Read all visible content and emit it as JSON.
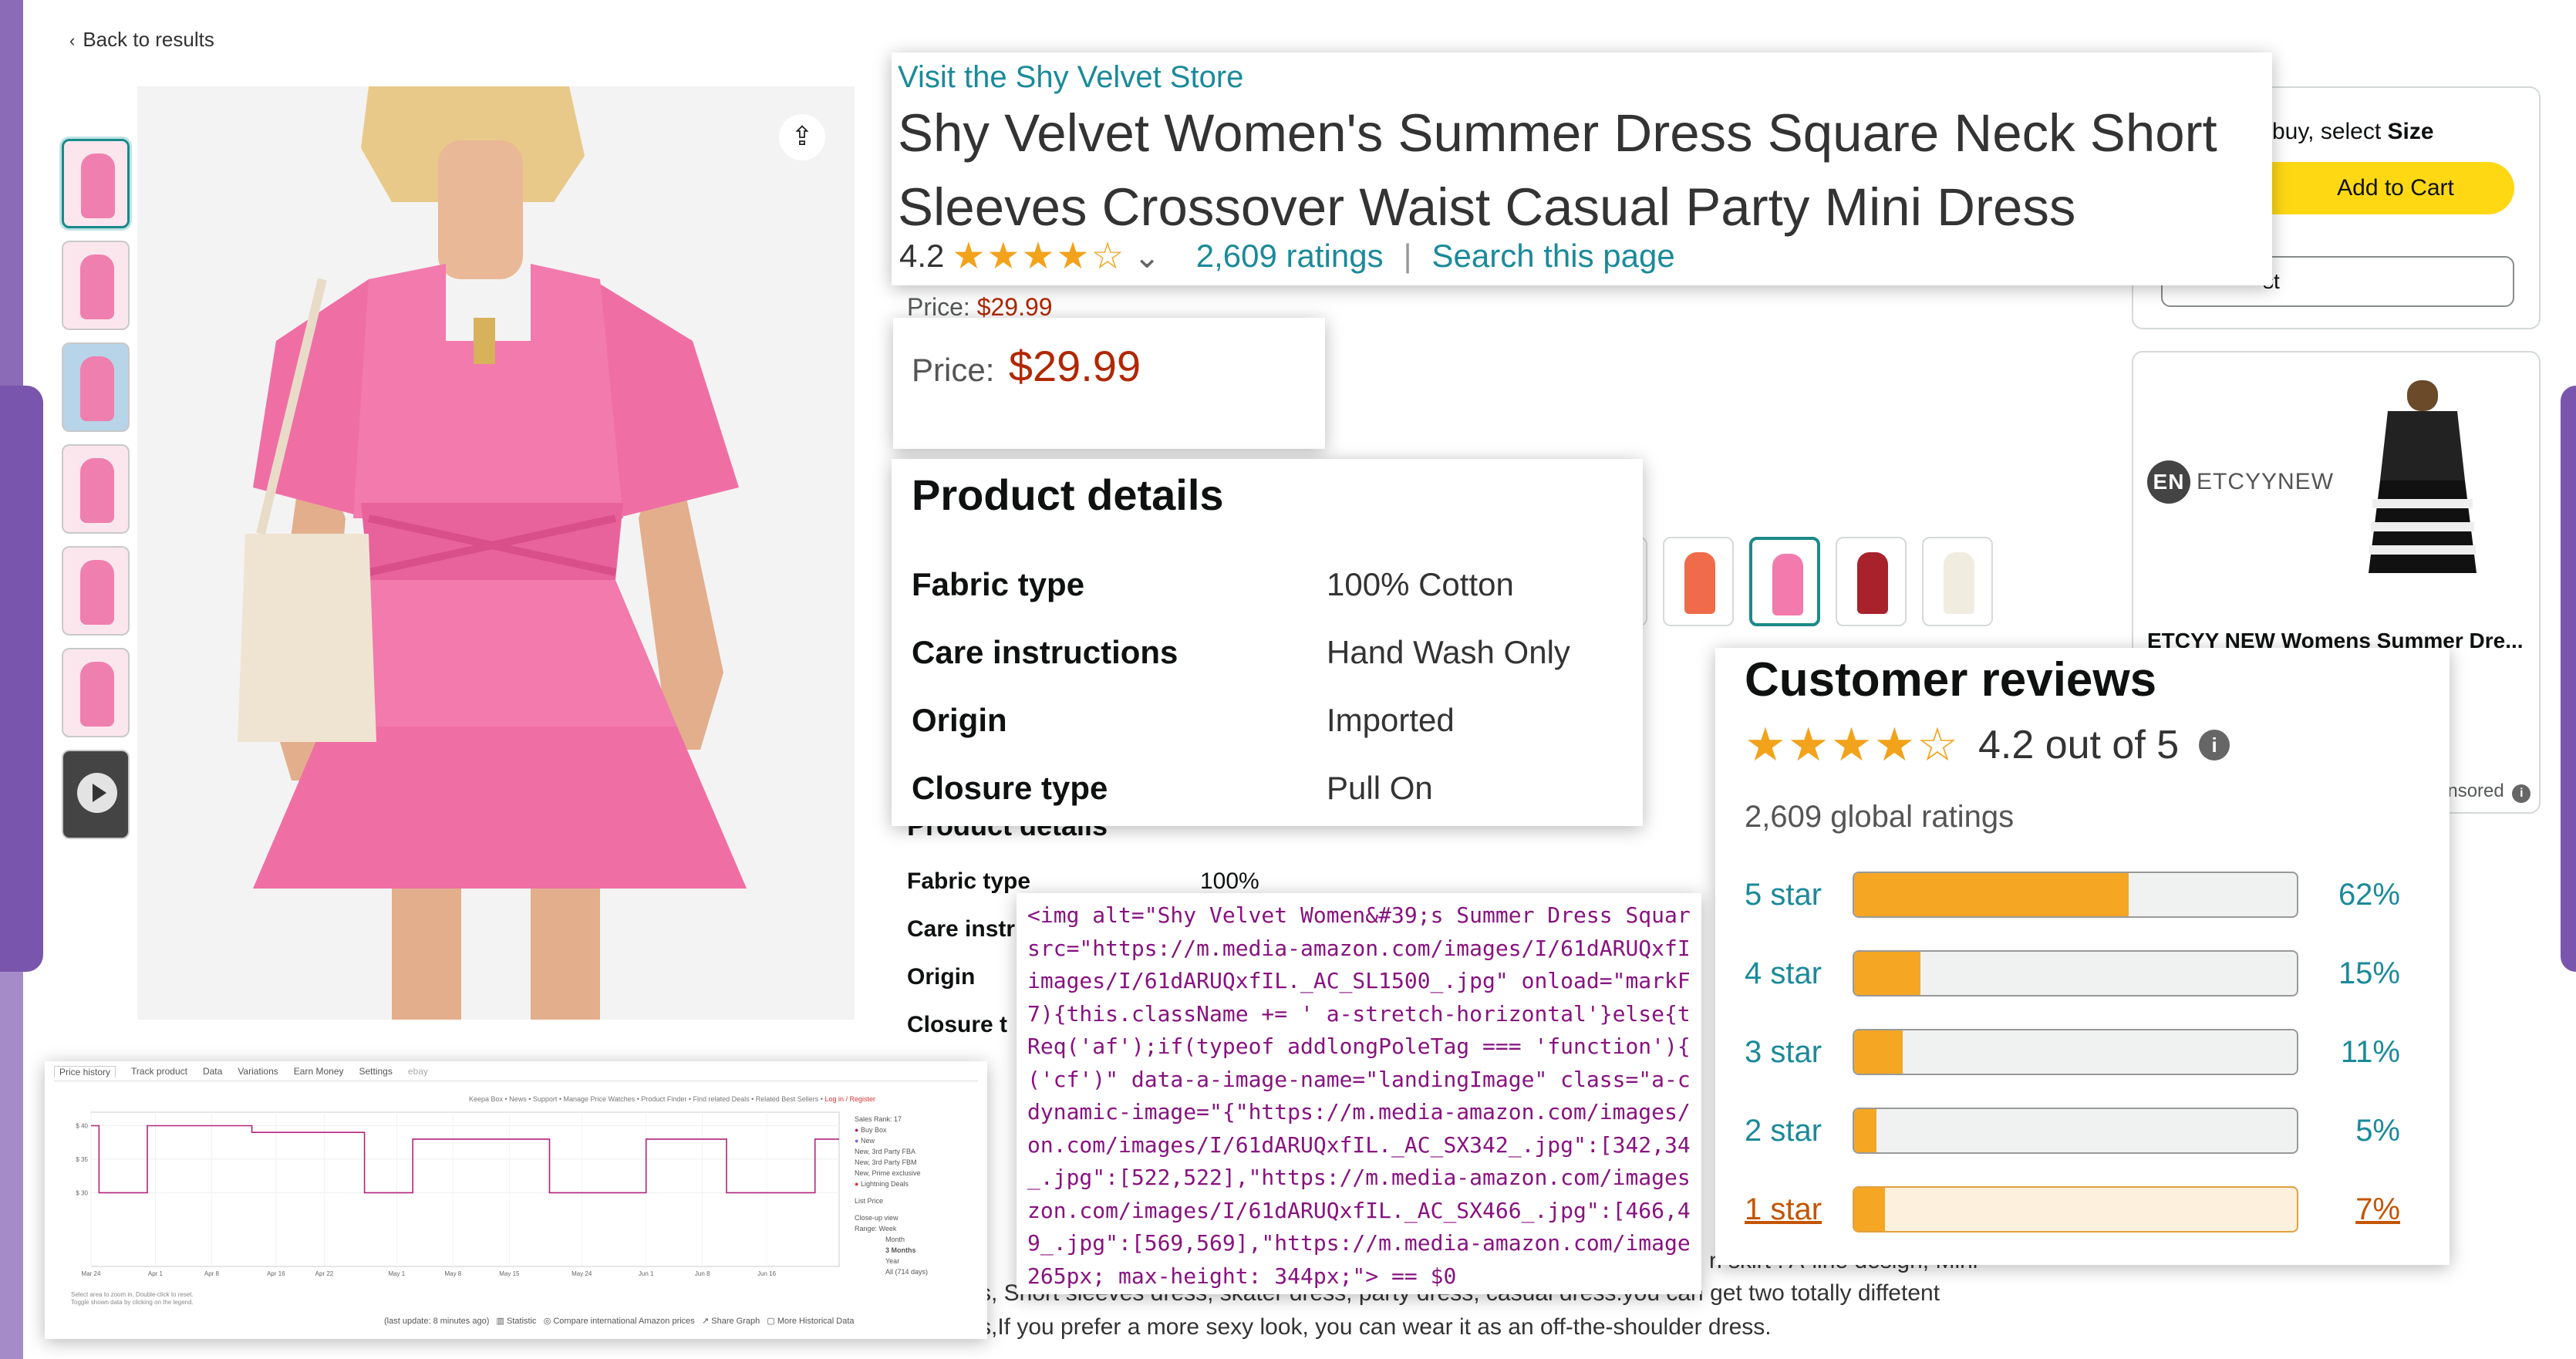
{
  "nav": {
    "back_label": "Back to results"
  },
  "main_image": {
    "alt": "Shy Velvet Women's Summer Dress Square Neck Short Sleeves Crossover Waist Casual Party Mini Dress"
  },
  "colors": {
    "accent": "#1a8a9a",
    "price": "#b12704",
    "star": "#f2a21b",
    "cart": "#ffd814",
    "chart_line": "#b0247a"
  },
  "title_card": {
    "store_link": "Visit the Shy Velvet Store",
    "title_line1": "Shy Velvet Women's Summer Dress Square Neck Short",
    "title_line2": "Sleeves Crossover Waist Casual Party Mini Dress",
    "rating_value": "4.2",
    "stars": "★★★★☆",
    "chevron": "⌄",
    "ratings_link": "2,609 ratings",
    "separator": "|",
    "search_link": "Search this page"
  },
  "base": {
    "price_label": "Price:",
    "price_value": "$29.99",
    "details_title": "Product details",
    "rows": [
      {
        "k": "Fabric type",
        "v": "100% Cotton"
      },
      {
        "k": "Care instr",
        "v": ""
      },
      {
        "k": "Origin",
        "v": ""
      },
      {
        "k": "Closure t",
        "v": ""
      }
    ],
    "desc_line1": "n skirt . A-line design, Mini",
    "desc_line2": "s, Short sleeves dress, skater dress, party dress, casual dress.you can get two totally diffetent",
    "desc_line3": "s,If you prefer a more sexy look, you can wear it as an off-the-shoulder dress."
  },
  "price_card": {
    "label": "Price:",
    "value": "$29.99"
  },
  "details_card": {
    "title": "Product details",
    "rows": [
      {
        "k": "Fabric type",
        "v": "100% Cotton"
      },
      {
        "k": "Care instructions",
        "v": "Hand Wash Only"
      },
      {
        "k": "Origin",
        "v": "Imported"
      },
      {
        "k": "Closure type",
        "v": "Pull On"
      }
    ]
  },
  "buybox": {
    "hint_prefix": "buy, select",
    "hint_bold": "Size",
    "add_to_cart": "Add to Cart",
    "list_btn": "st"
  },
  "sponsored": {
    "brand": "ETCYYNEW",
    "brand_mark": "EN",
    "title": "ETCYY NEW Womens Summer Dre...",
    "sponsored_label": "onsored"
  },
  "code": {
    "lines": [
      "<img alt=\"Shy Velvet Women&#39;s Summer Dress Squar",
      "src=\"https://m.media-amazon.com/images/I/61dARUQxfI",
      "images/I/61dARUQxfIL._AC_SL1500_.jpg\" onload=\"markF",
      "7){this.className += ' a-stretch-horizontal'}else{t",
      "Req('af');if(typeof addlongPoleTag === 'function'){",
      "('cf')\" data-a-image-name=\"landingImage\" class=\"a-c",
      "dynamic-image=\"{\"https://m.media-amazon.com/images/",
      "on.com/images/I/61dARUQxfIL._AC_SX342_.jpg\":[342,34",
      "_.jpg\":[522,522],\"https://m.media-amazon.com/images",
      "zon.com/images/I/61dARUQxfIL._AC_SX466_.jpg\":[466,4",
      "9_.jpg\":[569,569],\"https://m.media-amazon.com/image",
      "265px; max-height: 344px;\"> == $0"
    ]
  },
  "reviews": {
    "title": "Customer reviews",
    "stars": "★★★★☆",
    "summary": "4.2 out of 5",
    "info": "i",
    "global": "2,609 global ratings",
    "rows": [
      {
        "label": "5 star",
        "pct": "62%",
        "value": 62
      },
      {
        "label": "4 star",
        "pct": "15%",
        "value": 15
      },
      {
        "label": "3 star",
        "pct": "11%",
        "value": 11
      },
      {
        "label": "2 star",
        "pct": "5%",
        "value": 5
      },
      {
        "label": "1 star",
        "pct": "7%",
        "value": 7
      }
    ]
  },
  "keepa": {
    "tabs": [
      "Price history",
      "Track product",
      "Data",
      "Variations",
      "Earn Money",
      "Settings",
      "ebay"
    ],
    "links": "Keepa Box  •  News  •  Support  •  Manage Price Watches  •  Product Finder  •  Find related Deals  •  Related Best Sellers  •",
    "links_login": "Log in / Register",
    "legend": [
      "Sales Rank: 17",
      "Buy Box",
      "New",
      "New, 3rd Party FBA",
      "New, 3rd Party FBM",
      "New, Prime exclusive",
      "Lightning Deals",
      "",
      "List Price",
      "",
      "Close-up view",
      "Range:  Week",
      "Month",
      "3 Months",
      "Year",
      "All (714 days)"
    ],
    "footer": [
      "(last update: 8 minutes ago)",
      "Statistic",
      "Compare international Amazon prices",
      "Share Graph",
      "More Historical Data"
    ],
    "selection_hint": [
      "Select area to zoom in. Double-click to reset.",
      "Toggle shown data by clicking on the legend."
    ]
  },
  "chart_data": {
    "type": "line",
    "title": "",
    "xlabel": "",
    "ylabel": "",
    "x_ticks": [
      "Mar 24",
      "Apr 1",
      "Apr 8",
      "Apr 16",
      "Apr 22",
      "May 1",
      "May 8",
      "May 15",
      "May 24",
      "Jun 1",
      "Jun 8",
      "Jun 16"
    ],
    "y_ticks": [
      "$ 40",
      "$ 35",
      "$ 30"
    ],
    "ylim": [
      19,
      42
    ],
    "series": [
      {
        "name": "Buy Box",
        "x": [
          "Mar 24",
          "Mar 25",
          "Mar 25",
          "Mar 31",
          "Mar 31",
          "Apr 13",
          "Apr 13",
          "Apr 27",
          "Apr 27",
          "May 3",
          "May 3",
          "May 20",
          "May 20",
          "Jun 1",
          "Jun 1",
          "Jun 11",
          "Jun 11",
          "Jun 22",
          "Jun 22",
          "Jun 25"
        ],
        "values": [
          39.99,
          39.99,
          29.99,
          29.99,
          39.99,
          39.99,
          38.99,
          38.99,
          29.99,
          29.99,
          37.99,
          37.99,
          29.99,
          29.99,
          37.99,
          37.99,
          29.99,
          29.99,
          37.99,
          37.99
        ]
      }
    ]
  }
}
